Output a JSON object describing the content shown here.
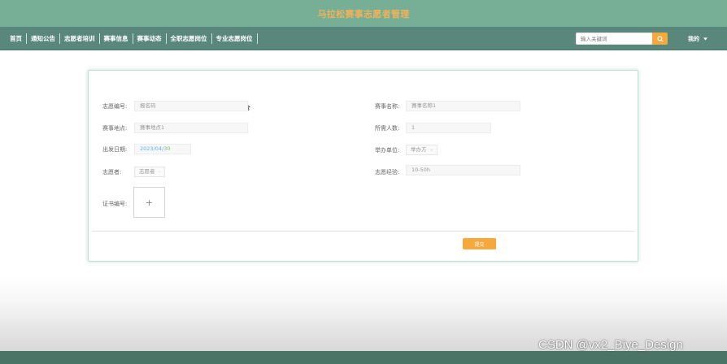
{
  "header": {
    "site_title": "马拉松赛事志愿者管理",
    "nav_items": [
      "首页",
      "通知公告",
      "志愿者培训",
      "赛事信息",
      "赛事动态",
      "全职志愿岗位",
      "专业志愿岗位"
    ],
    "search_placeholder": "输入关键词",
    "search_icon": "search-icon",
    "user_menu_label": "我的",
    "user_menu_icon": "caret-down-icon"
  },
  "form": {
    "fields": {
      "volunteer_no": {
        "label": "志愿编号:",
        "value": "报名码"
      },
      "event_name": {
        "label": "赛事名称:",
        "value": "赛事名称1"
      },
      "event_location": {
        "label": "赛事地点:",
        "value": "赛事地点1"
      },
      "required_count": {
        "label": "所需人数:",
        "value": "1"
      },
      "start_date": {
        "label": "出发日期:",
        "value_date": "2023/04/",
        "value_day": "30"
      },
      "organizer": {
        "label": "举办单位:",
        "value": "举办方"
      },
      "volunteer": {
        "label": "志愿者:",
        "value": "志愿者"
      },
      "volunteer_experience": {
        "label": "志愿经验:",
        "value": "10-50h"
      },
      "certificate": {
        "label": "证书编号:",
        "upload_icon": "plus-icon",
        "upload_symbol": "+"
      }
    },
    "submit_label": "提交"
  },
  "watermark": "CSDN @vx2_Biye_Design",
  "colors": {
    "title_bar": "#76ae96",
    "nav_bar": "#5a877c",
    "title_text": "#f2b259",
    "accent": "#f4a83e",
    "card_border": "#bfe3d6"
  }
}
